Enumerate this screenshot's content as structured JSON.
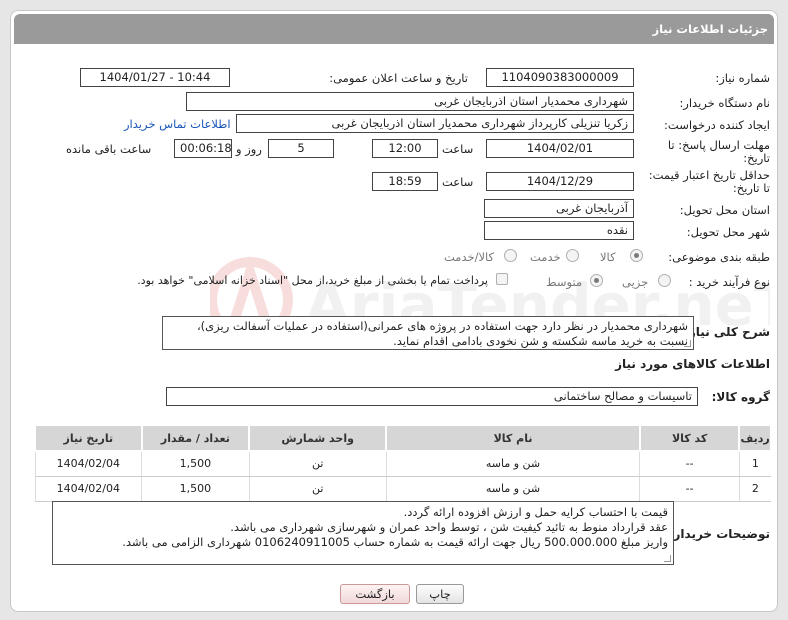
{
  "header": {
    "title": "جزئیات اطلاعات نیاز"
  },
  "fields": {
    "need_number_label": "شماره نیاز:",
    "need_number": "1104090383000009",
    "announce_label": "تاریخ و ساعت اعلان عمومی:",
    "announce_value": "1404/01/27 - 10:44",
    "buyer_org_label": "نام دستگاه خریدار:",
    "buyer_org": "شهرداری محمدیار استان اذربایجان غربی",
    "creator_label": "ایجاد کننده درخواست:",
    "creator": "زکریا تنزیلی کارپرداز شهرداری محمدیار استان اذربایجان غربی",
    "contact_link": "اطلاعات تماس خریدار",
    "reply_deadline_label_1": "مهلت ارسال پاسخ: تا",
    "reply_deadline_label_2": "تاریخ:",
    "reply_date": "1404/02/01",
    "time_label": "ساعت",
    "reply_time": "12:00",
    "days_value": "5",
    "days_label": "روز و",
    "remaining_time": "00:06:18",
    "remaining_label": "ساعت باقی مانده",
    "price_valid_label_1": "حداقل تاریخ اعتبار قیمت:",
    "price_valid_label_2": "تا تاریخ:",
    "price_valid_date": "1404/12/29",
    "price_valid_time": "18:59",
    "province_label": "استان محل تحویل:",
    "province": "آذربایجان غربی",
    "city_label": "شهر محل تحویل:",
    "city": "نقده",
    "category_label": "طبقه بندی موضوعی:",
    "category_options": [
      "کالا",
      "خدمت",
      "کالا/خدمت"
    ],
    "process_label": "نوع فرآیند خرید :",
    "process_options": [
      "جزیی",
      "متوسط"
    ],
    "payment_note": "پرداخت تمام یا بخشی از مبلغ خرید،از محل \"اسناد خزانه اسلامی\" خواهد بود."
  },
  "description": {
    "label": "شرح کلی نیاز:",
    "text": "شهرداری محمدیار در نظر دارد جهت استفاده در پروژه های عمرانی(استفاده در عملیات آسفالت ریزی)، نسبت به خرید ماسه شکسته و شن نخودی بادامی  اقدام نماید."
  },
  "goods": {
    "section_title": "اطلاعات کالاهای مورد نیاز",
    "group_label": "گروه کالا:",
    "group_value": "تاسیسات و مصالح ساختمانی",
    "columns": [
      "ردیف",
      "کد کالا",
      "نام کالا",
      "واحد شمارش",
      "تعداد / مقدار",
      "تاریخ نیاز"
    ],
    "rows": [
      {
        "row": "1",
        "code": "--",
        "name": "شن و ماسه",
        "unit": "تن",
        "qty": "1,500",
        "date": "1404/02/04"
      },
      {
        "row": "2",
        "code": "--",
        "name": "شن و ماسه",
        "unit": "تن",
        "qty": "1,500",
        "date": "1404/02/04"
      }
    ]
  },
  "buyer_notes": {
    "label": "توضیحات خریدار:",
    "lines": [
      "قیمت با احتساب کرایه حمل و ارزش افزوده ارائه گردد.",
      "عقد قرارداد منوط به تائید کیفیت شن ، توسط واحد عمران و شهرسازی شهرداری می باشد.",
      "واریز مبلغ 500.000.000 ریال جهت ارائه قیمت به شماره حساب 0106240911005 شهرداری الزامی می باشد."
    ]
  },
  "buttons": {
    "print": "چاپ",
    "back": "بازگشت"
  },
  "watermark": {
    "text": "AriaTender.neT"
  }
}
